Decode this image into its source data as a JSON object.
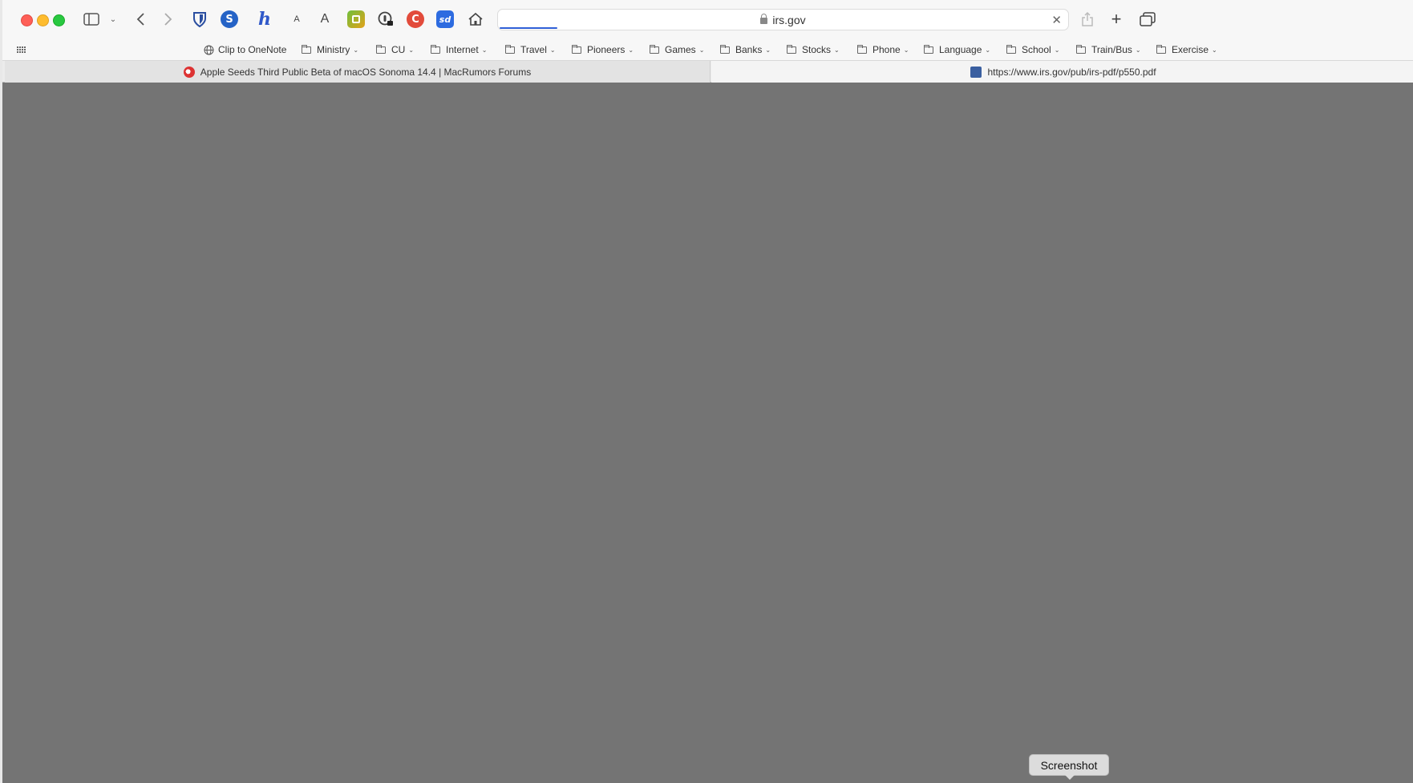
{
  "toolbar": {
    "font_small_label": "A",
    "font_large_label": "A",
    "extension_s_label": "S",
    "extension_h_label": "h",
    "extension_sd_label": "sd",
    "extension_c_label": "C"
  },
  "address_bar": {
    "url": "irs.gov"
  },
  "bookmarks": [
    {
      "label": "Clip to OneNote",
      "type": "link",
      "icon": "globe-icon"
    },
    {
      "label": "Ministry",
      "type": "folder"
    },
    {
      "label": "CU",
      "type": "folder"
    },
    {
      "label": "Internet",
      "type": "folder"
    },
    {
      "label": "Travel",
      "type": "folder"
    },
    {
      "label": "Pioneers",
      "type": "folder"
    },
    {
      "label": "Games",
      "type": "folder"
    },
    {
      "label": "Banks",
      "type": "folder"
    },
    {
      "label": "Stocks",
      "type": "folder"
    },
    {
      "label": "Phone",
      "type": "folder"
    },
    {
      "label": "Language",
      "type": "folder"
    },
    {
      "label": "School",
      "type": "folder"
    },
    {
      "label": "Train/Bus",
      "type": "folder"
    },
    {
      "label": "Exercise",
      "type": "folder"
    }
  ],
  "tabs": [
    {
      "title": "Apple Seeds Third Public Beta of macOS Sonoma 14.4 | MacRumors Forums",
      "active": false,
      "favicon": "macrumors-icon"
    },
    {
      "title": "https://www.irs.gov/pub/irs-pdf/p550.pdf",
      "active": true,
      "favicon": "irs-icon"
    }
  ],
  "tooltip": {
    "text": "Screenshot"
  },
  "colors": {
    "content_background": "#747474",
    "chrome_background": "#f7f7f7",
    "progress_accent": "#2f5fd6"
  }
}
